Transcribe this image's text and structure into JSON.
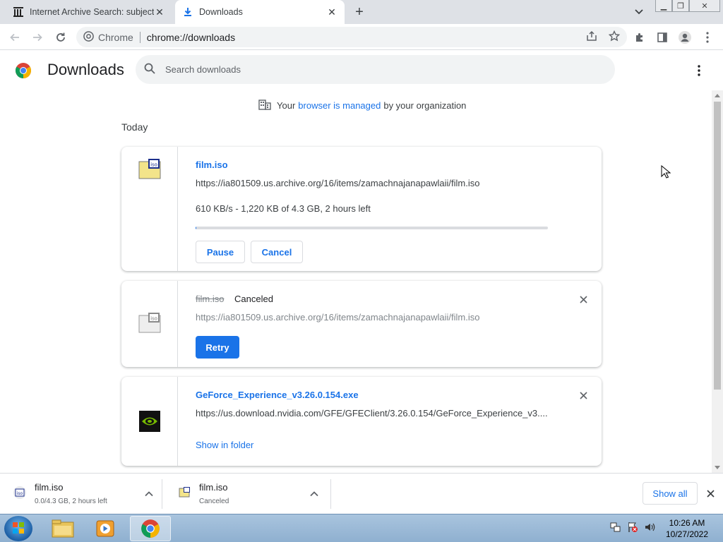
{
  "tabs": [
    {
      "title": "Internet Archive Search: subject:\"",
      "icon": "archive-icon"
    },
    {
      "title": "Downloads",
      "icon": "download-icon"
    }
  ],
  "toolbar": {
    "site_label": "Chrome",
    "url": "chrome://downloads"
  },
  "header": {
    "title": "Downloads",
    "search_placeholder": "Search downloads"
  },
  "managed_notice": {
    "prefix": "Your",
    "link": "browser is managed",
    "suffix": "by your organization"
  },
  "section_label": "Today",
  "downloads": [
    {
      "name": "film.iso",
      "url": "https://ia801509.us.archive.org/16/items/zamachnajanapawlaii/film.iso",
      "progress_text": "610 KB/s - 1,220 KB of 4.3 GB, 2 hours left",
      "progress_fraction": 0.0003,
      "pause_label": "Pause",
      "cancel_label": "Cancel"
    },
    {
      "name": "film.iso",
      "status": "Canceled",
      "url": "https://ia801509.us.archive.org/16/items/zamachnajanapawlaii/film.iso",
      "retry_label": "Retry"
    },
    {
      "name": "GeForce_Experience_v3.26.0.154.exe",
      "url": "https://us.download.nvidia.com/GFE/GFEClient/3.26.0.154/GeForce_Experience_v3....",
      "show_label": "Show in folder"
    }
  ],
  "shelf": {
    "items": [
      {
        "name": "film.iso",
        "status": "0.0/4.3 GB, 2 hours left"
      },
      {
        "name": "film.iso",
        "status": "Canceled"
      }
    ],
    "show_all_label": "Show all"
  },
  "taskbar": {
    "time": "10:26 AM",
    "date": "10/27/2022"
  },
  "colors": {
    "accent": "#1a73e8",
    "tabstrip": "#dee1e6",
    "taskbar": "#a9c4de"
  }
}
